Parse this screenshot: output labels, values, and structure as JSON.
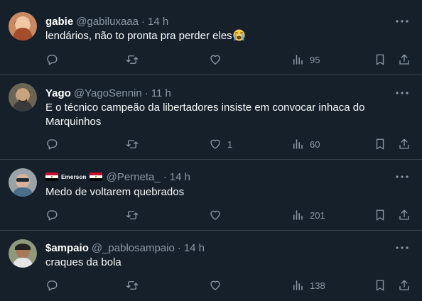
{
  "theme": {
    "background": "#15202b",
    "divider": "#38444d",
    "muted": "#8b98a5",
    "text": "#f7f9f9"
  },
  "tweets": [
    {
      "name": "gabie",
      "handle": "@gabiluxaaa",
      "separator": "·",
      "time": "14 h",
      "text": "lendários, não to pronta pra perder eles",
      "emoji": "loudly-crying-face",
      "likes": "",
      "views": "95"
    },
    {
      "name": "Yago",
      "handle": "@YagoSennin",
      "separator": "·",
      "time": "11 h",
      "text": "E o técnico campeão da libertadores insiste em convocar inhaca do Marquinhos",
      "likes": "1",
      "views": "60"
    },
    {
      "name": "Emerson",
      "name_style": "flag-decorated",
      "handle": "@Perneta_",
      "separator": "·",
      "time": "14 h",
      "text": "Medo de voltarem quebrados",
      "likes": "",
      "views": "201"
    },
    {
      "name": "$ampaio",
      "handle": "@_pablosampaio",
      "separator": "·",
      "time": "14 h",
      "text": "craques da bola",
      "likes": "",
      "views": "138"
    }
  ],
  "icons": {
    "reply": "reply-icon",
    "retweet": "retweet-icon",
    "like": "heart-icon",
    "views": "views-icon",
    "bookmark": "bookmark-icon",
    "share": "share-icon",
    "more": "more-icon"
  }
}
